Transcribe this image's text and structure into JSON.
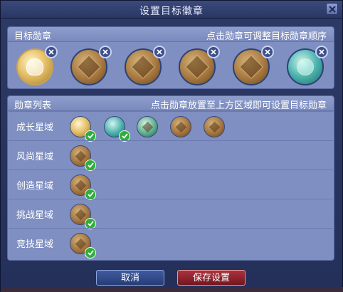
{
  "window": {
    "title": "设置目标徽章"
  },
  "target_section": {
    "title": "目标勋章",
    "hint": "点击勋章可调整目标勋章顺序",
    "badges": [
      {
        "icon": "gold-lotus-badge-icon"
      },
      {
        "icon": "bronze-diamond-badge-icon"
      },
      {
        "icon": "bronze-flower-badge-icon"
      },
      {
        "icon": "bronze-cube-badge-icon"
      },
      {
        "icon": "bronze-leaf-badge-icon"
      },
      {
        "icon": "teal-swirl-badge-icon"
      }
    ]
  },
  "list_section": {
    "title": "勋章列表",
    "hint": "点击勋章放置至上方区域即可设置目标勋章",
    "rows": [
      {
        "label": "成长星域"
      },
      {
        "label": "风尚星域"
      },
      {
        "label": "创造星域"
      },
      {
        "label": "挑战星域"
      },
      {
        "label": "竞技星域"
      }
    ]
  },
  "buttons": {
    "cancel": "取消",
    "save": "保存设置"
  },
  "colors": {
    "panel": "#7f8fc1",
    "check": "#2fae3c",
    "save": "#8e1f2a",
    "cancel": "#2f4a8c"
  }
}
